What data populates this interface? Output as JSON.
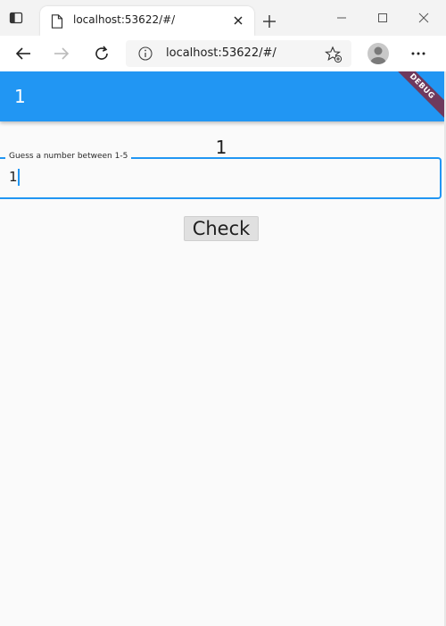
{
  "browser": {
    "tab_title": "localhost:53622/#/",
    "url": "localhost:53622/#/",
    "icons": {
      "tab_actions": "tab-actions-icon",
      "favicon": "page-icon",
      "close": "close-icon",
      "new_tab": "plus-icon",
      "minimize": "minimize-icon",
      "maximize": "maximize-icon",
      "window_close": "close-icon",
      "back": "back-arrow-icon",
      "forward": "forward-arrow-icon",
      "refresh": "refresh-icon",
      "info": "info-icon",
      "favorites": "favorites-star-icon",
      "profile": "profile-avatar-icon",
      "more": "more-icon"
    }
  },
  "app": {
    "appbar_title": "1",
    "debug_banner": "DEBUG",
    "result_text": "1",
    "input": {
      "label": "Guess a number between 1-5",
      "value": "1"
    },
    "check_button": "Check"
  },
  "colors": {
    "primary": "#2196f3",
    "background": "#fafafa",
    "button_bg": "#e0e0e0",
    "debug_banner": "#a00000"
  }
}
